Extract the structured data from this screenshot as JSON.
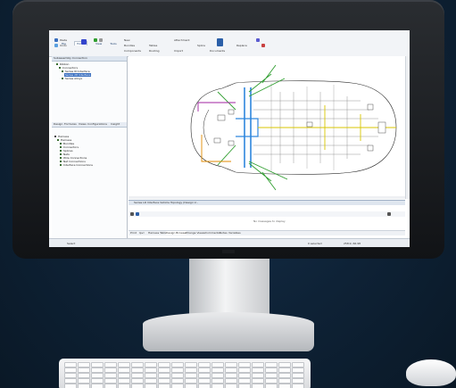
{
  "ribbon": {
    "tabs": [
      "File",
      "Home",
      "View",
      "Tools"
    ],
    "groups": [
      "Paste",
      "Undo",
      "Components",
      "Routing",
      "Documents"
    ],
    "labels": [
      "New",
      "Bundles",
      "Tables",
      "Attachment",
      "Import",
      "Splice",
      "Replace"
    ]
  },
  "panel": {
    "top_title": "Subassembly Connection",
    "tree_items": [
      "Ribbon",
      "Connectors",
      "Series ID Interface",
      "Series 28 Interface",
      "Series Alloys"
    ],
    "tabs": [
      "Design",
      "Formulas",
      "Views",
      "Configurations",
      "Insight"
    ],
    "design_items": [
      "Harness",
      "Harness",
      "Bundles",
      "Connectors",
      "Splices",
      "Nets",
      "Wire Connections",
      "Net Connections",
      "Interface Connections"
    ]
  },
  "document": {
    "title": "Series LR Interface Vehicle Topology (Design V..."
  },
  "messages": {
    "empty": "No messages to display"
  },
  "bottom_tabs": [
    "Print",
    "Ipvr",
    "Harness Table",
    "Design Browser",
    "Change Viewer",
    "Comments",
    "Notes",
    "Variables"
  ],
  "status": {
    "left": "Select",
    "selection": "0 selected",
    "coords": "258.9, 66.98"
  },
  "colors": {
    "harness_blue": "#2e86de",
    "harness_green": "#2f9e2f",
    "harness_yellow": "#d8c600",
    "harness_purple": "#a020a0",
    "harness_orange": "#e08a00",
    "outline": "#2a2a2a",
    "bg": "#0e2236"
  }
}
